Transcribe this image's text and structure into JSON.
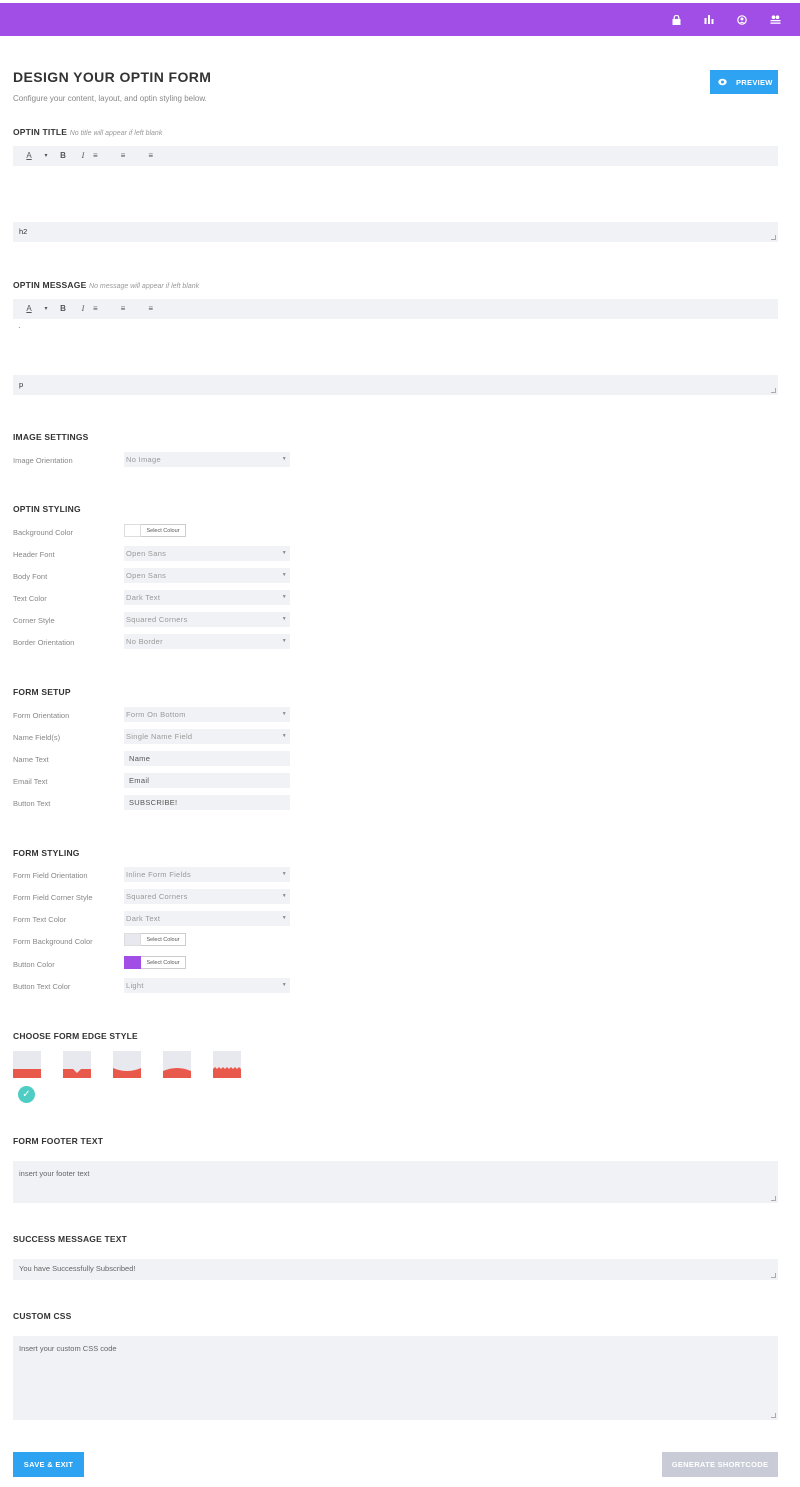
{
  "topbar": {
    "color": "#a14ee6",
    "icons": [
      "lock-icon",
      "bar-chart-icon",
      "user-circle-icon",
      "users-icon"
    ]
  },
  "header": {
    "title": "DESIGN YOUR OPTIN FORM",
    "subtitle": "Configure your content, layout, and optin styling below.",
    "preview_label": "PREVIEW"
  },
  "optin_title": {
    "label": "OPTIN TITLE",
    "hint": "No title will appear if left blank",
    "toolbar": [
      "A",
      "▾",
      "B",
      "I",
      "≡",
      "≡",
      "≡"
    ],
    "tag": "h2"
  },
  "optin_message": {
    "label": "OPTIN MESSAGE",
    "hint": "No message will appear if left blank",
    "toolbar": [
      "A",
      "▾",
      "B",
      "I",
      "≡",
      "≡",
      "≡"
    ],
    "content": "·",
    "tag": "p"
  },
  "image_settings": {
    "label": "IMAGE SETTINGS",
    "fields": [
      {
        "label": "Image Orientation",
        "value": "No Image"
      }
    ]
  },
  "optin_styling": {
    "label": "OPTIN STYLING",
    "background_color": {
      "label": "Background Color",
      "button": "Select Colour",
      "swatch": "#ffffff"
    },
    "fields": [
      {
        "label": "Header Font",
        "value": "Open Sans"
      },
      {
        "label": "Body Font",
        "value": "Open Sans"
      },
      {
        "label": "Text Color",
        "value": "Dark Text"
      },
      {
        "label": "Corner Style",
        "value": "Squared Corners"
      },
      {
        "label": "Border Orientation",
        "value": "No Border"
      }
    ]
  },
  "form_setup": {
    "label": "FORM SETUP",
    "selects": [
      {
        "label": "Form Orientation",
        "value": "Form On Bottom"
      },
      {
        "label": "Name Field(s)",
        "value": "Single Name Field"
      }
    ],
    "inputs": [
      {
        "label": "Name Text",
        "value": "Name"
      },
      {
        "label": "Email Text",
        "value": "Email"
      },
      {
        "label": "Button Text",
        "value": "SUBSCRIBE!"
      }
    ]
  },
  "form_styling": {
    "label": "FORM STYLING",
    "selects": [
      {
        "label": "Form Field Orientation",
        "value": "Inline Form Fields"
      },
      {
        "label": "Form Field Corner Style",
        "value": "Squared Corners"
      },
      {
        "label": "Form Text Color",
        "value": "Dark Text"
      }
    ],
    "form_bg_color": {
      "label": "Form Background Color",
      "button": "Select Colour",
      "swatch": "#e8e9ee"
    },
    "button_color": {
      "label": "Button Color",
      "button": "Select Colour",
      "swatch": "#a14ee6"
    },
    "button_text_color": {
      "label": "Button Text Color",
      "value": "Light"
    }
  },
  "edge_style": {
    "label": "CHOOSE FORM EDGE STYLE",
    "options": [
      "flat",
      "triangle",
      "curve-down",
      "curve-up",
      "zigzag"
    ],
    "selected": 0,
    "accent": "#e8584b"
  },
  "footer_text": {
    "label": "FORM FOOTER TEXT",
    "placeholder": "insert your footer text"
  },
  "success_message": {
    "label": "SUCCESS MESSAGE TEXT",
    "value": "You have Successfully Subscribed!"
  },
  "custom_css": {
    "label": "CUSTOM CSS",
    "placeholder": "Insert your custom CSS code"
  },
  "actions": {
    "save_label": "SAVE & EXIT",
    "generate_label": "GENERATE SHORTCODE"
  }
}
